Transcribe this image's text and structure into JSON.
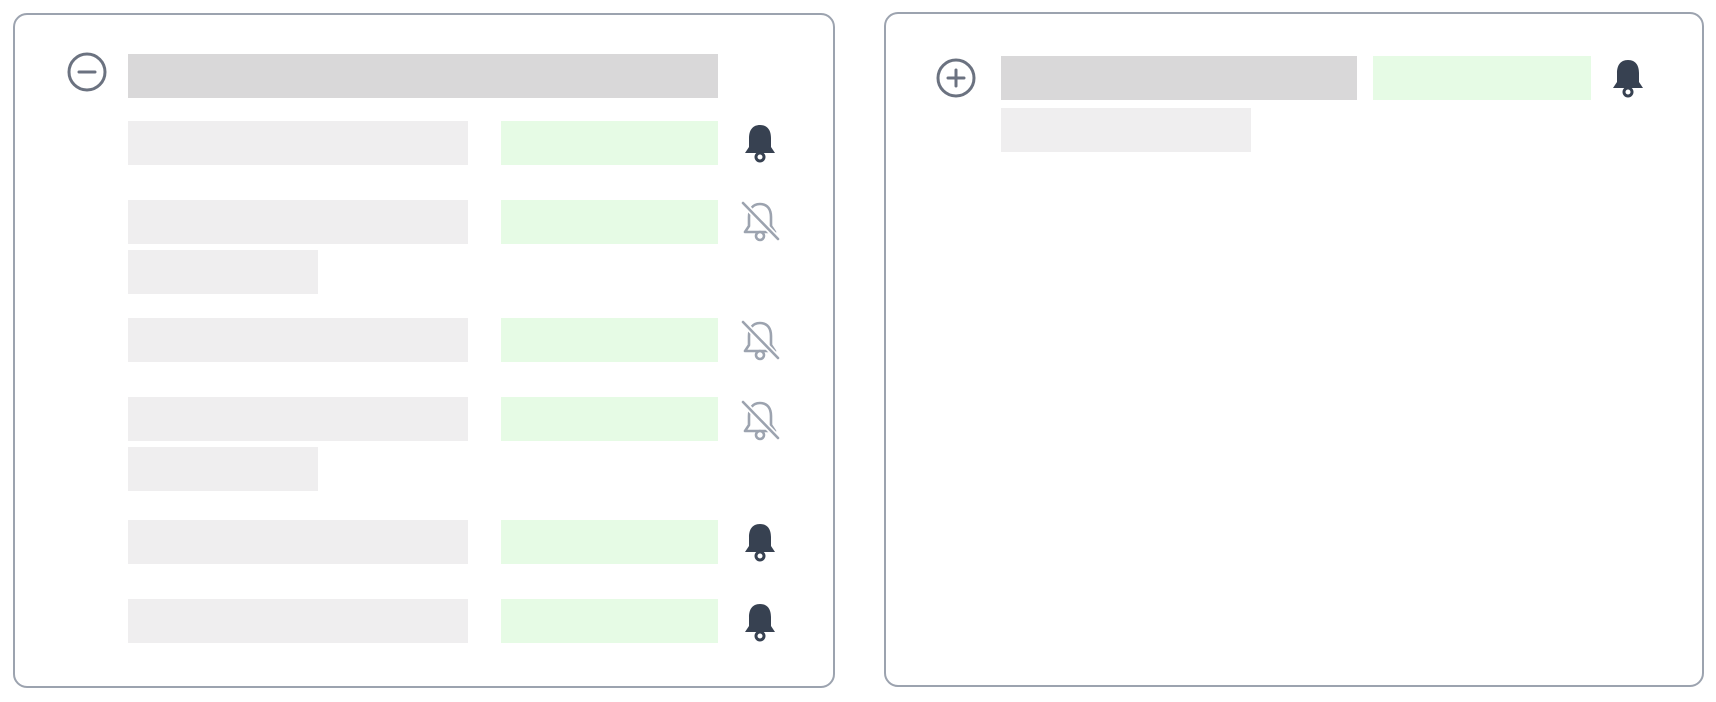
{
  "colors": {
    "panel_border": "#9ca3af",
    "bar_dark": "#d9d8d9",
    "bar_light": "#efeeef",
    "bar_green": "#e6fbe5",
    "bell_on": "#374151",
    "bell_off": "#9ca3af",
    "toggle_icon": "#6b7280"
  },
  "left_panel": {
    "toggle_icon": "minus-circle-icon",
    "expanded": true,
    "rows": [
      {
        "bell_icon": "bell-icon",
        "notifications_on": true,
        "secondary_line": false
      },
      {
        "bell_icon": "bell-off-icon",
        "notifications_on": false,
        "secondary_line": true
      },
      {
        "bell_icon": "bell-off-icon",
        "notifications_on": false,
        "secondary_line": false
      },
      {
        "bell_icon": "bell-off-icon",
        "notifications_on": false,
        "secondary_line": true
      },
      {
        "bell_icon": "bell-icon",
        "notifications_on": true,
        "secondary_line": false
      },
      {
        "bell_icon": "bell-icon",
        "notifications_on": true,
        "secondary_line": false
      }
    ]
  },
  "right_panel": {
    "toggle_icon": "plus-circle-icon",
    "expanded": false,
    "header_row": {
      "bell_icon": "bell-icon",
      "notifications_on": true,
      "secondary_line": true
    }
  }
}
